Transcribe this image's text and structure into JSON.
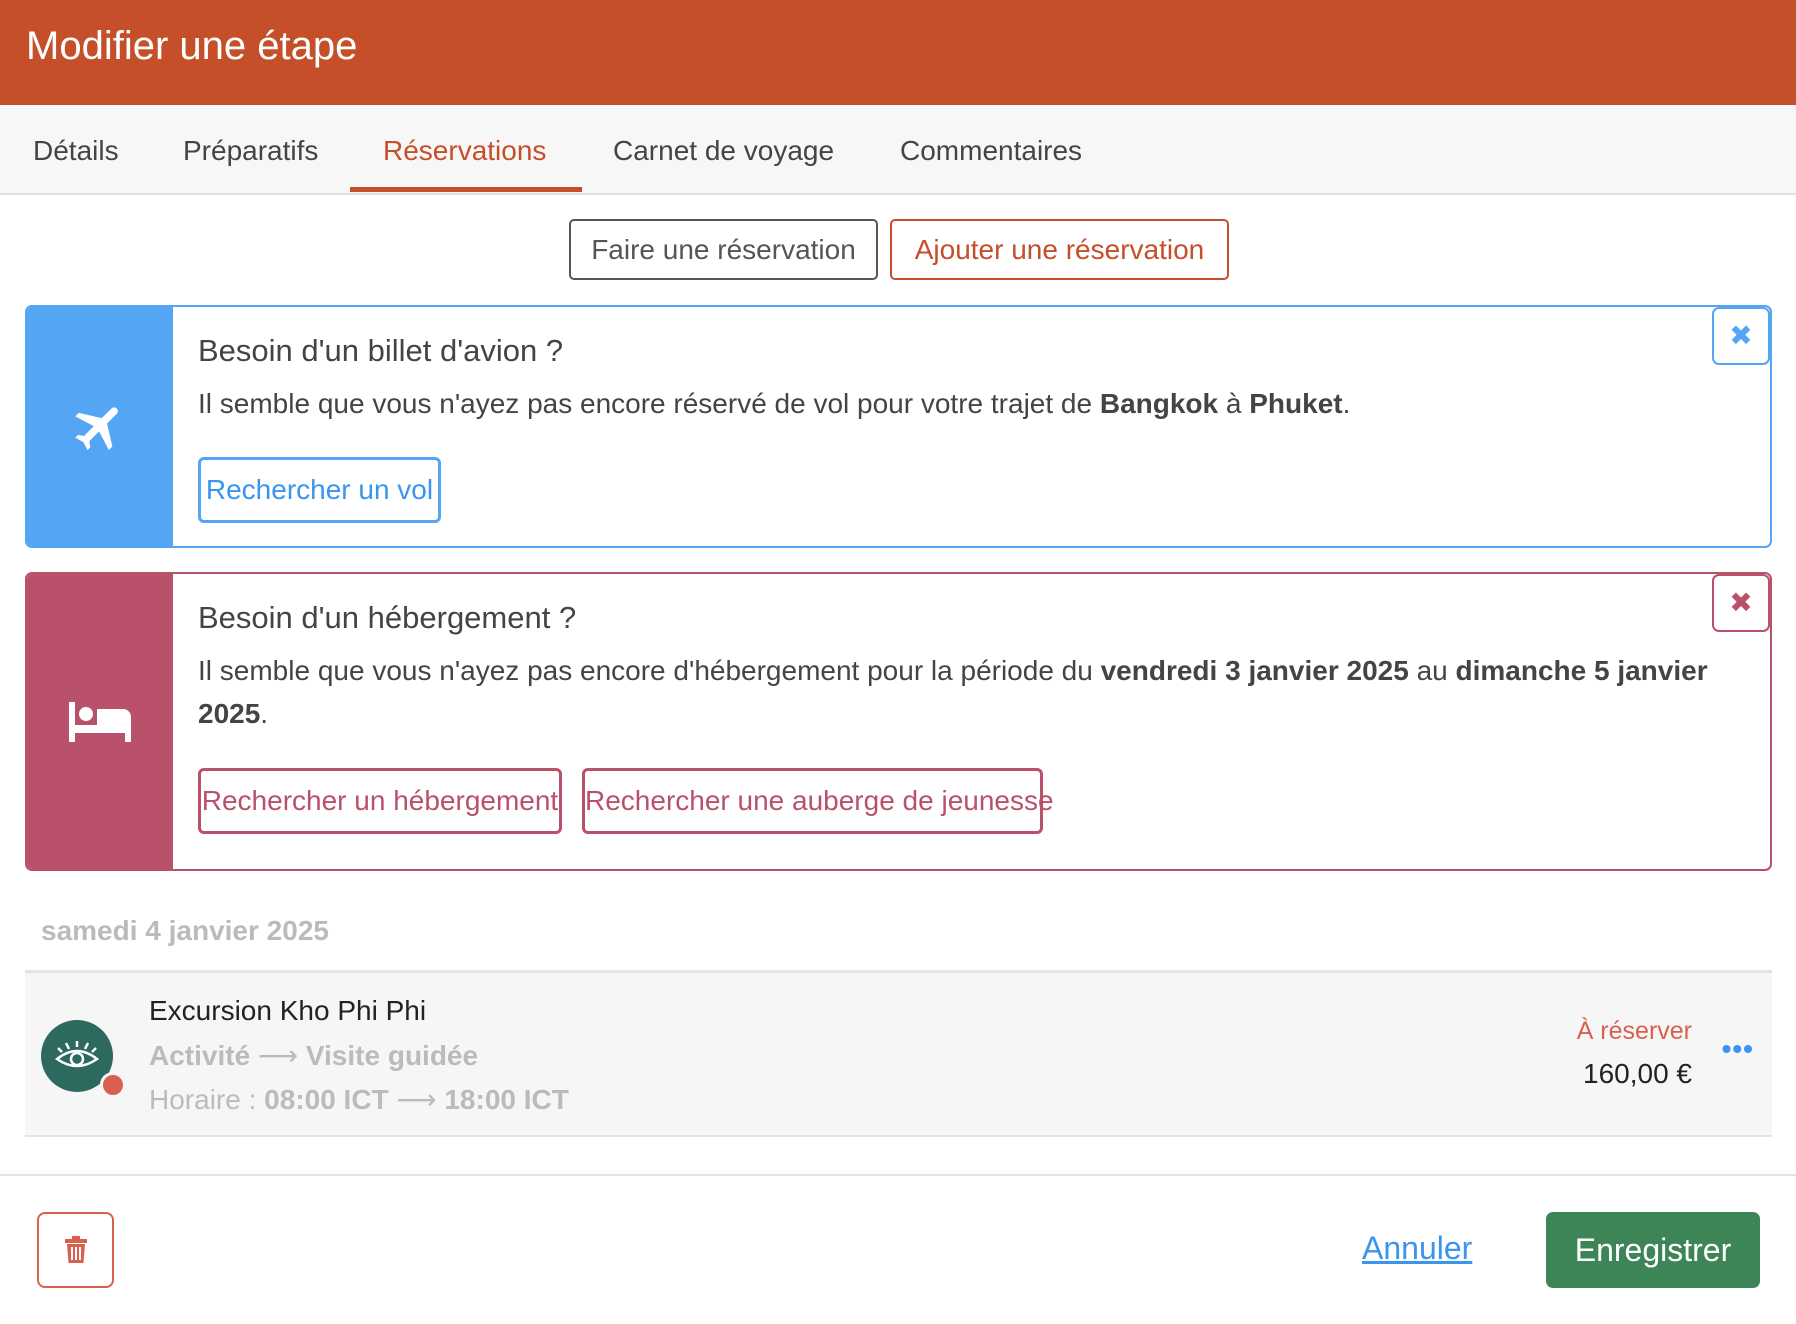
{
  "header": {
    "title": "Modifier une étape",
    "color": "#c44f29"
  },
  "tabs": [
    {
      "label": "Détails"
    },
    {
      "label": "Préparatifs"
    },
    {
      "label": "Réservations",
      "active": true
    },
    {
      "label": "Carnet de voyage"
    },
    {
      "label": "Commentaires"
    }
  ],
  "actions": {
    "make_reservation": "Faire une réservation",
    "add_reservation": "Ajouter une réservation"
  },
  "flight_card": {
    "icon": "plane-icon",
    "color": "#55a5f5",
    "title": "Besoin d'un billet d'avion ?",
    "text_before": "Il semble que vous n'ayez pas encore réservé de vol pour votre trajet de ",
    "from": "Bangkok",
    "text_mid": " à ",
    "to": "Phuket",
    "text_after": ".",
    "button": "Rechercher un vol",
    "close": "✖"
  },
  "hotel_card": {
    "icon": "bed-icon",
    "color": "#b9516a",
    "title": "Besoin d'un hébergement ?",
    "text_before": "Il semble que vous n'ayez pas encore d'hébergement pour la période du ",
    "start": "vendredi 3 janvier 2025",
    "text_mid": " au ",
    "end": "dimanche 5 janvier 2025",
    "text_after": ".",
    "button_hotel": "Rechercher un hébergement",
    "button_hostel": "Rechercher une auberge de jeunesse",
    "close": "✖"
  },
  "day": {
    "label": "samedi 4 janvier 2025"
  },
  "item": {
    "icon": "eye-icon",
    "title": "Excursion Kho Phi Phi",
    "category": "Activité",
    "arrow": "⟶",
    "subcategory": "Visite guidée",
    "schedule_label": "Horaire : ",
    "time_start": "08:00 ICT",
    "time_end": "18:00 ICT",
    "status": "À réserver",
    "status_color": "#d9604e",
    "price": "160,00 €",
    "more": "•••"
  },
  "footer": {
    "cancel": "Annuler",
    "save": "Enregistrer",
    "save_color": "#3d8557",
    "delete_icon": "trash-icon"
  }
}
